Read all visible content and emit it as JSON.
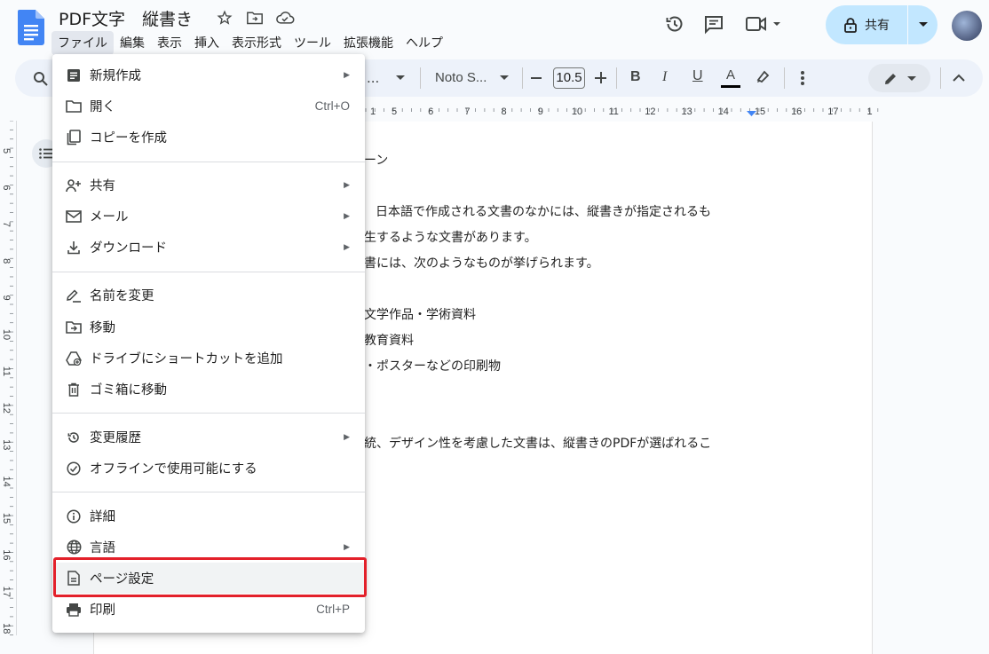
{
  "header": {
    "doc_title": "PDF文字　縦書き",
    "share_label": "共有"
  },
  "menubar": [
    "ファイル",
    "編集",
    "表示",
    "挿入",
    "表示形式",
    "ツール",
    "拡張機能",
    "ヘルプ"
  ],
  "toolbar": {
    "font_name": "Noto S...",
    "font_size": "10.5",
    "style_partial": "..."
  },
  "ruler": {
    "numbers": [
      "1",
      "5",
      "6",
      "7",
      "8",
      "9",
      "10",
      "11",
      "12",
      "13",
      "14",
      "15",
      "16",
      "17",
      "1"
    ]
  },
  "vertical_ruler": [
    "5",
    "6",
    "7",
    "8",
    "9",
    "10",
    "11",
    "12",
    "13",
    "14",
    "15",
    "16",
    "17",
    "18"
  ],
  "document": {
    "lines": [
      "ーン",
      "日本語で作成される文書のなかには、縦書きが指定されるも",
      "生するような文書があります。",
      "書には、次のようなものが挙げられます。",
      "文学作品・学術資料",
      "教育資料",
      "・ポスターなどの印刷物",
      "統、デザイン性を考慮した文書は、縦書きのPDFが選ばれるこ"
    ]
  },
  "file_menu": {
    "items": [
      {
        "label": "新規作成",
        "icon": "new-doc-icon",
        "submenu": true
      },
      {
        "label": "開く",
        "icon": "folder-icon",
        "shortcut": "Ctrl+O"
      },
      {
        "label": "コピーを作成",
        "icon": "copy-icon"
      },
      {
        "label": "共有",
        "icon": "person-add-icon",
        "submenu": true
      },
      {
        "label": "メール",
        "icon": "mail-icon",
        "submenu": true
      },
      {
        "label": "ダウンロード",
        "icon": "download-icon",
        "submenu": true
      },
      {
        "label": "名前を変更",
        "icon": "rename-icon"
      },
      {
        "label": "移動",
        "icon": "move-folder-icon"
      },
      {
        "label": "ドライブにショートカットを追加",
        "icon": "drive-shortcut-icon"
      },
      {
        "label": "ゴミ箱に移動",
        "icon": "trash-icon"
      },
      {
        "label": "変更履歴",
        "icon": "history-icon",
        "submenu": true
      },
      {
        "label": "オフラインで使用可能にする",
        "icon": "offline-icon"
      },
      {
        "label": "詳細",
        "icon": "info-icon"
      },
      {
        "label": "言語",
        "icon": "globe-icon",
        "submenu": true
      },
      {
        "label": "ページ設定",
        "icon": "page-setup-icon",
        "highlighted": true
      },
      {
        "label": "印刷",
        "icon": "print-icon",
        "shortcut": "Ctrl+P"
      }
    ]
  },
  "colors": {
    "accent": "#1a73e8",
    "highlight_border": "#e3202a",
    "share_bg": "#c2e7ff"
  }
}
